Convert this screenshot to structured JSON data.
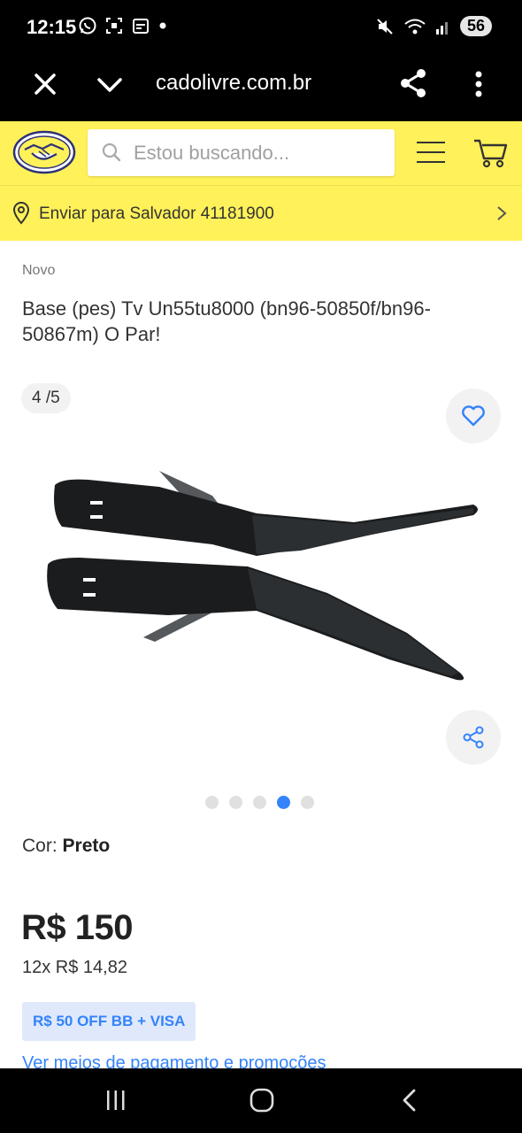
{
  "status_bar": {
    "time": "12:15",
    "battery": "56",
    "icons_left": [
      "whatsapp-icon",
      "screenshot-icon",
      "calendar-icon",
      "dot-icon"
    ],
    "icons_right": [
      "mute-icon",
      "wifi-icon",
      "signal-icon"
    ]
  },
  "browser": {
    "url": "cadolivre.com.br",
    "icons": [
      "close-icon",
      "chevron-down-icon",
      "share-icon",
      "more-vert-icon"
    ]
  },
  "header": {
    "search_placeholder": "Estou buscando...",
    "delivery_text": "Enviar para Salvador 41181900",
    "brand_color": "#fff159"
  },
  "product": {
    "condition": "Novo",
    "title": "Base (pes) Tv Un55tu8000 (bn96-50850f/bn96-50867m) O Par!",
    "gallery_counter": "4 /5",
    "gallery_total": 5,
    "gallery_active_index": 4,
    "color_label": "Cor:",
    "color_value": "Preto",
    "price": "R$ 150",
    "installments": "12x R$ 14,82",
    "promo": "R$ 50 OFF BB + VISA",
    "payment_link": "Ver meios de pagamento e promoções",
    "accent_color": "#3483fa"
  }
}
